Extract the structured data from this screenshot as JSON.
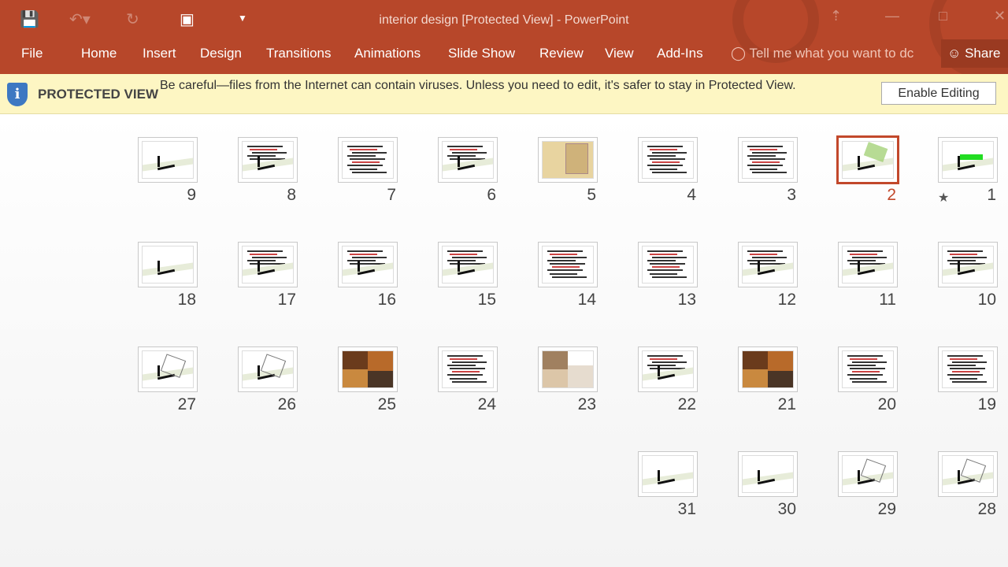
{
  "window": {
    "title": "interior design [Protected View] - PowerPoint",
    "accent": "#b7472a"
  },
  "qat": {
    "save": "save-icon",
    "undo": "undo-icon",
    "redo": "redo-icon",
    "present": "present-from-start-icon",
    "customize": "customize-icon"
  },
  "ribbon": {
    "tabs": [
      "File",
      "Home",
      "Insert",
      "Design",
      "Transitions",
      "Animations",
      "Slide Show",
      "Review",
      "View",
      "Add-Ins"
    ],
    "tell_me": "Tell me what you want to dc",
    "share": "Share"
  },
  "protected_view": {
    "label": "PROTECTED VIEW",
    "message": "Be careful—files from the Internet can contain viruses. Unless you need to edit, it's safer to stay in Protected View.",
    "button": "Enable Editing"
  },
  "slides": {
    "selected": "2",
    "rows": [
      [
        {
          "n": "9",
          "k": "plan"
        },
        {
          "n": "8",
          "k": "textplan"
        },
        {
          "n": "7",
          "k": "text"
        },
        {
          "n": "6",
          "k": "textplan"
        },
        {
          "n": "5",
          "k": "sepia"
        },
        {
          "n": "4",
          "k": "text"
        },
        {
          "n": "3",
          "k": "text"
        },
        {
          "n": "2",
          "k": "plan3d"
        },
        {
          "n": "1",
          "k": "title",
          "star": true
        }
      ],
      [
        {
          "n": "18",
          "k": "plan"
        },
        {
          "n": "17",
          "k": "textplan"
        },
        {
          "n": "16",
          "k": "textplan"
        },
        {
          "n": "15",
          "k": "textplan"
        },
        {
          "n": "14",
          "k": "text"
        },
        {
          "n": "13",
          "k": "text"
        },
        {
          "n": "12",
          "k": "textplan"
        },
        {
          "n": "11",
          "k": "textplan"
        },
        {
          "n": "10",
          "k": "textplan"
        }
      ],
      [
        {
          "n": "27",
          "k": "sketch"
        },
        {
          "n": "26",
          "k": "sketch"
        },
        {
          "n": "25",
          "k": "photo"
        },
        {
          "n": "24",
          "k": "text"
        },
        {
          "n": "23",
          "k": "photo2"
        },
        {
          "n": "22",
          "k": "textplan"
        },
        {
          "n": "21",
          "k": "photo"
        },
        {
          "n": "20",
          "k": "text"
        },
        {
          "n": "19",
          "k": "text"
        }
      ],
      [
        null,
        null,
        null,
        null,
        null,
        {
          "n": "31",
          "k": "plan"
        },
        {
          "n": "30",
          "k": "plan"
        },
        {
          "n": "29",
          "k": "sketch"
        },
        {
          "n": "28",
          "k": "sketch"
        }
      ]
    ]
  }
}
